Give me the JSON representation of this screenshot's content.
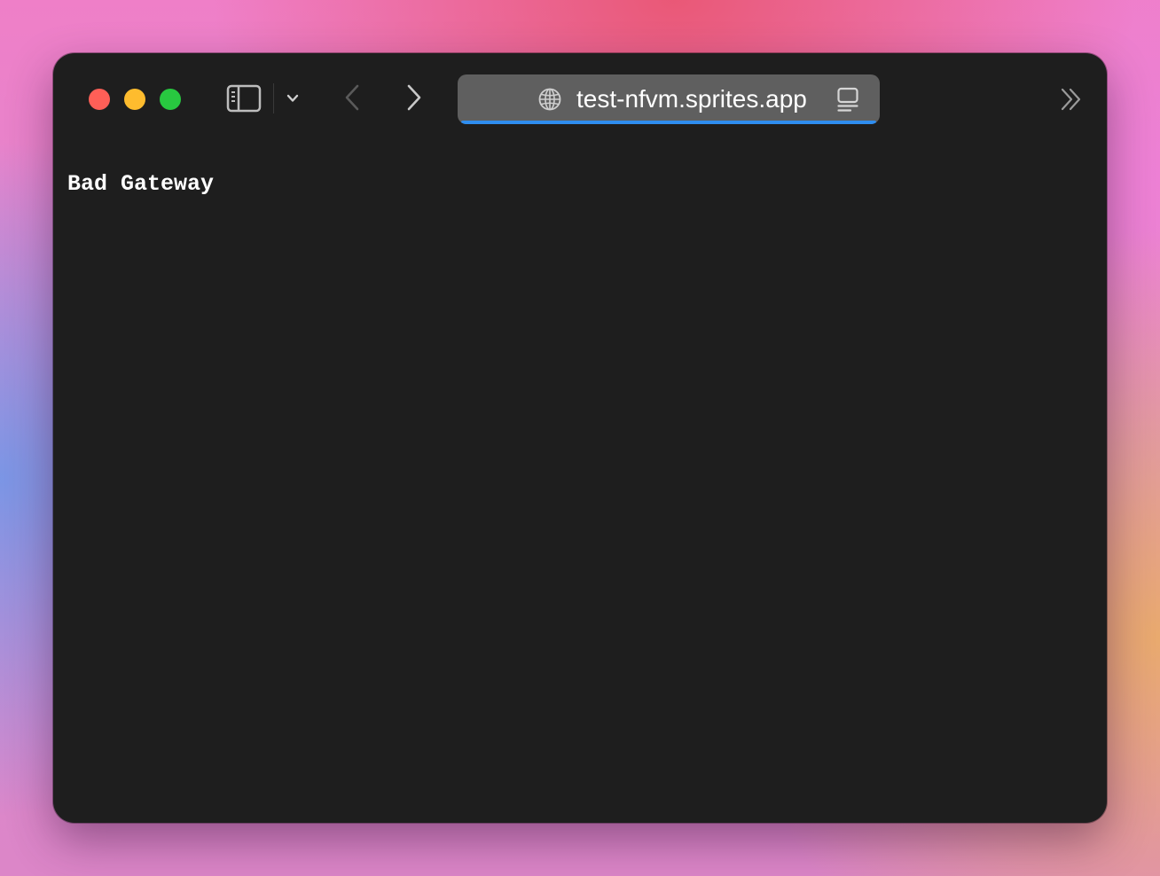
{
  "browser": {
    "address_bar": {
      "url": "test-nfvm.sprites.app"
    },
    "icons": {
      "sidebar": "sidebar-icon",
      "dropdown": "chevron-down-icon",
      "back": "chevron-left-icon",
      "forward": "chevron-right-icon",
      "site": "globe-icon",
      "reader": "reader-mode-icon",
      "overflow": "double-chevron-right-icon"
    },
    "colors": {
      "close": "#ff5f57",
      "minimize": "#febc2e",
      "zoom": "#28c840",
      "window_background": "#1e1e1e",
      "address_bar_background": "#5f5f5f",
      "load_progress": "#2f8ef0"
    }
  },
  "page": {
    "body_text": "Bad Gateway"
  }
}
